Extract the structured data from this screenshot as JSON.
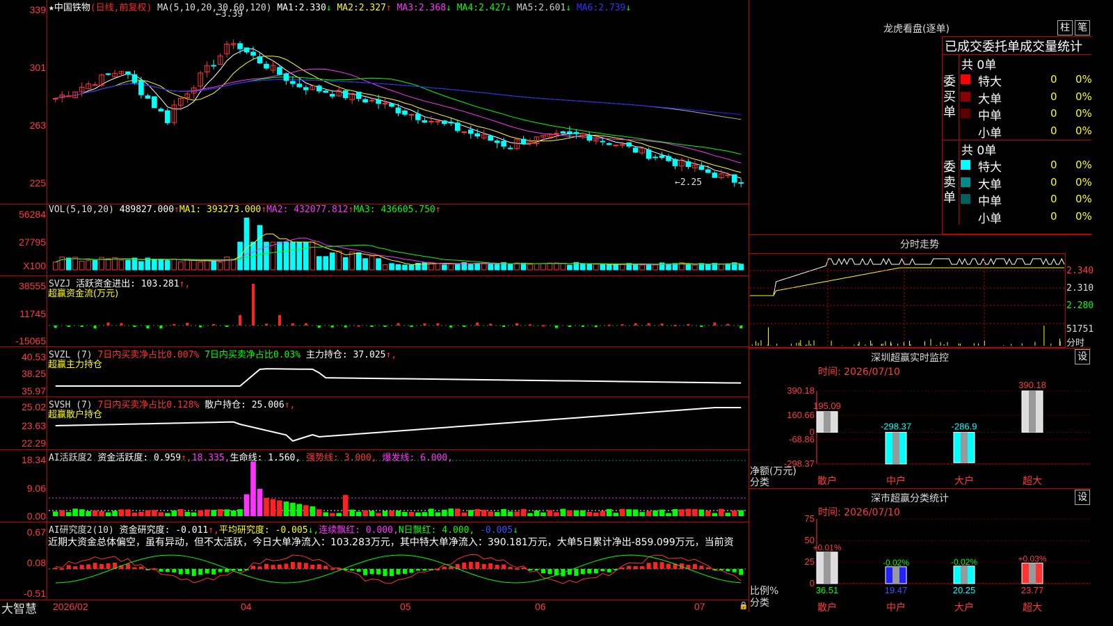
{
  "stock": {
    "name": "中国铁物",
    "mode": "(日线,前复权)",
    "star": "★"
  },
  "ma_line": {
    "label": "MA(5,10,20,30,60,120)",
    "items": [
      {
        "name": "MA1:",
        "value": "2.330",
        "arrow": "↓",
        "color": "#ffffff"
      },
      {
        "name": "MA2:",
        "value": "2.327",
        "arrow": "↑",
        "color": "#ffff00"
      },
      {
        "name": "MA3:",
        "value": "2.368",
        "arrow": "↓",
        "color": "#ff33ff"
      },
      {
        "name": "MA4:",
        "value": "2.427",
        "arrow": "↓",
        "color": "#00ff00"
      },
      {
        "name": "MA5:",
        "value": "2.601",
        "arrow": "↓",
        "color": "#cccccc"
      },
      {
        "name": "MA6:",
        "value": "2.739",
        "arrow": "↓",
        "color": "#2222ff"
      }
    ]
  },
  "price_axis": [
    "339",
    "301",
    "263",
    "225"
  ],
  "price_annot": {
    "high": "3.39",
    "low": "2.25",
    "high_arrow": "←",
    "low_arrow": "←"
  },
  "vol": {
    "label": "VOL(5,10,20)",
    "value": "489827.000",
    "arrow": "↑",
    "ma1": "MA1: 393273.000",
    "ma1a": "↑",
    "ma2": "MA2: 432077.812",
    "ma2a": "↑",
    "ma3": "MA3: 436605.750",
    "ma3a": "↑",
    "axis": [
      "56284",
      "27795",
      "X100"
    ]
  },
  "svzj": {
    "label": "SVZJ",
    "text": "活跃资金进出: 103.281",
    "arrow": "↑,",
    "sub": "超赢资金流(万元)",
    "axis": [
      "38555",
      "11745",
      "-15065"
    ]
  },
  "svzl": {
    "label": "SVZL (7)",
    "t1": "7日内买卖净占比0.007%",
    "t2": "7日内买卖净占比0.03%",
    "t3": "主力持仓: 37.025",
    "arrow": "↑,",
    "sub": "超赢主力持仓",
    "axis": [
      "40.53",
      "38.25",
      "35.97"
    ]
  },
  "svsh": {
    "label": "SVSH (7)",
    "t1": "7日内买卖净占比0.128%",
    "t2": "散户持仓: 25.006",
    "arrow": "↑,",
    "sub": "超赢散户持仓",
    "axis": [
      "25.02",
      "23.63",
      "22.29"
    ]
  },
  "ai1": {
    "label": "AI活跃度2",
    "t1": "资金活跃度: 0.959",
    "a1": "↑,",
    "t2": "18.335,",
    "t3": "生命线: 1.560,",
    "t4": "强势线: 3.000,",
    "t5": "爆发线: 6.000,",
    "axis": [
      "18.34",
      "9.06",
      "0.00"
    ]
  },
  "ai2": {
    "label": "AI研究度2(10)",
    "t1": "资金研究度: -0.011",
    "a1": "↑,",
    "t2": "平均研究度: -0.005",
    "a2": "↓,",
    "t3": "连续飘红: 0.000,",
    "t4": "N日飘红: 4.000,",
    "t5": "-0.005",
    "a5": "↓",
    "axis": [
      "0.67",
      "0.08",
      "-0.51"
    ],
    "comment": "近期大资金总体偏空，虽有异动，但不太活跃，今日大单净流入：103.283万元，其中特大单净流入：390.181万元，大单5日累计净出-859.099万元，当前资"
  },
  "xaxis": {
    "brand": "大智慧",
    "labels": [
      "2026/02",
      "04",
      "05",
      "06",
      "07"
    ]
  },
  "lhb": {
    "title": "龙虎看盘(逐单)",
    "btn1": "柱",
    "btn2": "笔",
    "subtitle": "已成交委托单成交量统计",
    "buy": {
      "side": "委买单",
      "total": "共 0单",
      "rows": [
        {
          "label": "特大",
          "value": "0",
          "pct": "0%",
          "color": "#ff0000"
        },
        {
          "label": "大单",
          "value": "0",
          "pct": "0%",
          "color": "#8b0000"
        },
        {
          "label": "中单",
          "value": "0",
          "pct": "0%",
          "color": "#5a0000"
        },
        {
          "label": "小单",
          "value": "0",
          "pct": "0%",
          "color": "#000000"
        }
      ]
    },
    "sell": {
      "side": "委卖单",
      "total": "共 0单",
      "rows": [
        {
          "label": "特大",
          "value": "0",
          "pct": "0%",
          "color": "#00ffff"
        },
        {
          "label": "大单",
          "value": "0",
          "pct": "0%",
          "color": "#008b8b"
        },
        {
          "label": "中单",
          "value": "0",
          "pct": "0%",
          "color": "#006060"
        },
        {
          "label": "小单",
          "value": "0",
          "pct": "0%",
          "color": "#000000"
        }
      ]
    }
  },
  "intraday": {
    "title": "分时走势",
    "axis": [
      "2.340",
      "2.310",
      "2.280",
      "51751",
      "分时"
    ]
  },
  "sz_monitor": {
    "title": "深圳超赢实时监控",
    "btn": "设",
    "date": "时间: 2026/07/10",
    "yaxis": [
      "390.18",
      "160.66",
      "0",
      "-68.86",
      "-298.37"
    ],
    "ylabel": "净额(万元)",
    "xlabel": "分类",
    "chart_data": {
      "type": "bar",
      "categories": [
        "散户",
        "中户",
        "大户",
        "超大"
      ],
      "values": [
        195.09,
        -298.37,
        -286.9,
        390.18
      ],
      "labels": [
        "195.09",
        "-298.37",
        "-286.9",
        "390.18"
      ],
      "ylim": [
        -298.37,
        390.18
      ],
      "colors": [
        "#dddddd",
        "#00ffff",
        "#00ffff",
        "#dddddd"
      ]
    }
  },
  "sz_class": {
    "title": "深市超赢分类统计",
    "btn": "设",
    "date": "时间: 2026/07/10",
    "yaxis": [
      "75",
      "50",
      "25",
      "0"
    ],
    "ylabel": "比例%",
    "xlabel": "分类",
    "chart_data": {
      "type": "bar",
      "categories": [
        "散户",
        "中户",
        "大户",
        "超大"
      ],
      "values": [
        36.51,
        19.47,
        20.25,
        23.77
      ],
      "changes": [
        "+0.01%",
        "-0.02%",
        "-0.02%",
        "+0.03%"
      ],
      "values_text": [
        "36.51",
        "19.47",
        "20.25",
        "23.77"
      ],
      "ylim": [
        0,
        75
      ],
      "colors": [
        "#dddddd",
        "#2222ff",
        "#00ffff",
        "#ff3333"
      ]
    }
  }
}
